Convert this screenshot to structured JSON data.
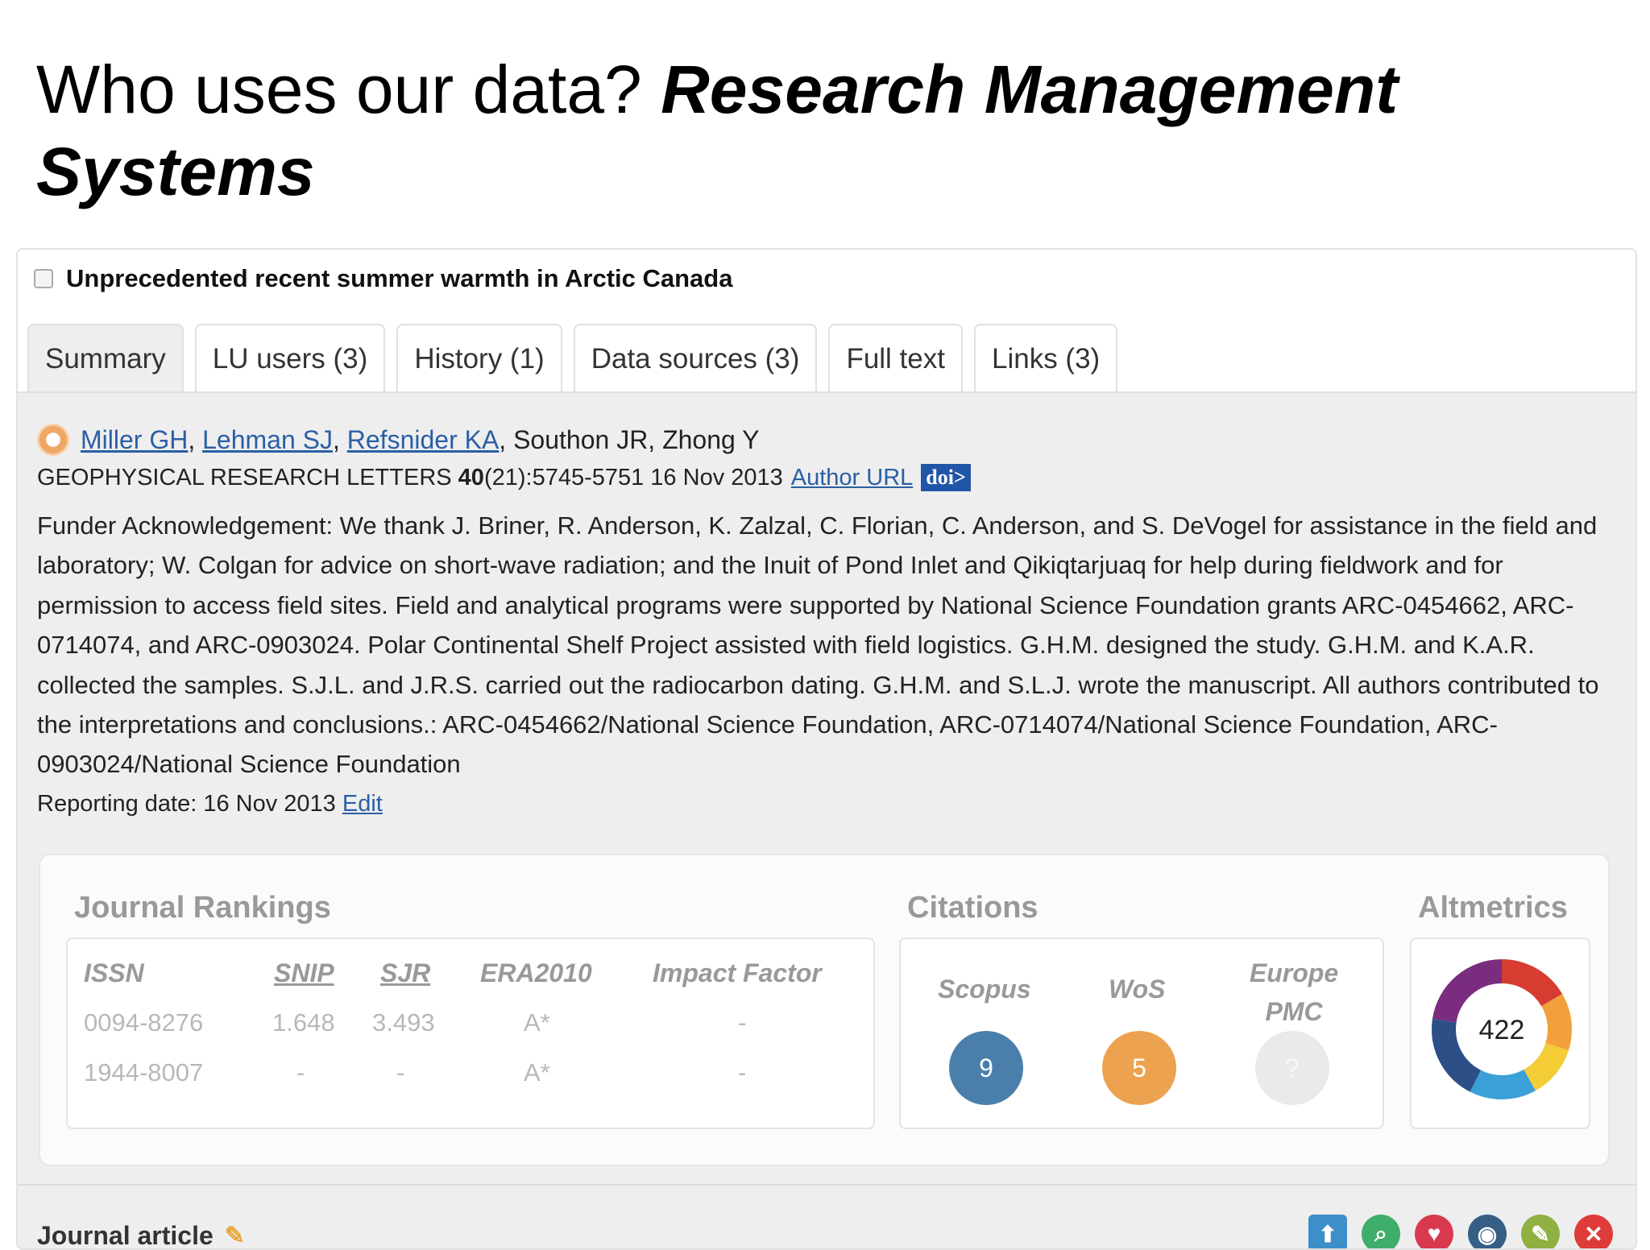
{
  "slide": {
    "title_plain": "Who uses our data? ",
    "title_emphasis": "Research Management Systems"
  },
  "record": {
    "title": "Unprecedented recent summer warmth in Arctic Canada",
    "tabs": [
      {
        "label": "Summary",
        "active": true
      },
      {
        "label": "LU users (3)"
      },
      {
        "label": "History (1)"
      },
      {
        "label": "Data sources (3)"
      },
      {
        "label": "Full text"
      },
      {
        "label": "Links (3)"
      }
    ],
    "authors": {
      "linked": [
        "Miller GH",
        "Lehman SJ",
        "Refsnider KA"
      ],
      "others": "Southon JR, Zhong Y"
    },
    "journal": {
      "name": "GEOPHYSICAL RESEARCH LETTERS",
      "volume": "40",
      "issue_pages_date": "(21):5745-5751 16 Nov 2013",
      "author_url_label": "Author URL",
      "doi_label": "doi>"
    },
    "acknowledgement": "Funder Acknowledgement: We thank J. Briner, R. Anderson, K. Zalzal, C. Florian, C. Anderson, and S. DeVogel for assistance in the field and laboratory; W. Colgan for advice on short-wave radiation; and the Inuit of Pond Inlet and Qikiqtarjuaq for help during fieldwork and for permission to access field sites. Field and analytical programs were supported by National Science Foundation grants ARC-0454662, ARC-0714074, and ARC-0903024. Polar Continental Shelf Project assisted with field logistics. G.H.M. designed the study. G.H.M. and K.A.R. collected the samples. S.J.L. and J.R.S. carried out the radiocarbon dating. G.H.M. and S.L.J. wrote the manuscript. All authors contributed to the interpretations and conclusions.: ARC-0454662/National Science Foundation, ARC-0714074/National Science Foundation, ARC-0903024/National Science Foundation",
    "reporting": {
      "label": "Reporting date: 16 Nov 2013",
      "edit_label": "Edit"
    },
    "rankings": {
      "title": "Journal Rankings",
      "headers": [
        "ISSN",
        "SNIP",
        "SJR",
        "ERA2010",
        "Impact Factor"
      ],
      "rows": [
        [
          "0094-8276",
          "1.648",
          "3.493",
          "A*",
          "-"
        ],
        [
          "1944-8007",
          "-",
          "-",
          "A*",
          "-"
        ]
      ]
    },
    "citations": {
      "title": "Citations",
      "sources": [
        {
          "label": "Scopus",
          "count": "9",
          "color": "#4a7fac"
        },
        {
          "label": "WoS",
          "count": "5",
          "color": "#eda24f"
        },
        {
          "label": "Europe PMC",
          "count": "?",
          "color": "#eaeaea"
        }
      ]
    },
    "altmetrics": {
      "title": "Altmetrics",
      "score": "422"
    },
    "footer": {
      "type_label": "Journal article",
      "actions": [
        {
          "icon": "upload-icon",
          "glyph": "⬆",
          "color": "#3d8fc9"
        },
        {
          "icon": "search-icon",
          "glyph": "⌕",
          "color": "#3fae6a"
        },
        {
          "icon": "heart-icon",
          "glyph": "♥",
          "color": "#d9394f"
        },
        {
          "icon": "eye-icon",
          "glyph": "◉",
          "color": "#355f85"
        },
        {
          "icon": "tag-icon",
          "glyph": "✎",
          "color": "#8fb043"
        },
        {
          "icon": "close-icon",
          "glyph": "✕",
          "color": "#e03b3b"
        }
      ]
    }
  }
}
